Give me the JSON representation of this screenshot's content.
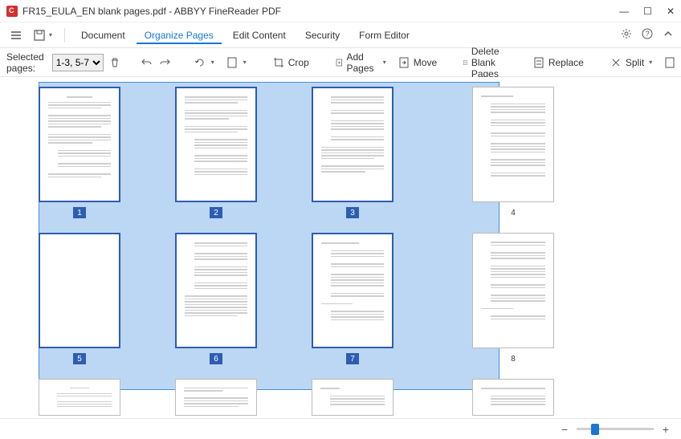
{
  "titlebar": {
    "document_name": "FR15_EULA_EN blank pages.pdf",
    "app_name": "ABBYY FineReader PDF"
  },
  "menubar": {
    "items": [
      "Document",
      "Organize Pages",
      "Edit Content",
      "Security",
      "Form Editor"
    ],
    "active_index": 1
  },
  "toolbar": {
    "selected_pages_label": "Selected pages:",
    "selected_pages_value": "1-3, 5-7",
    "crop_label": "Crop",
    "add_pages_label": "Add Pages",
    "move_label": "Move",
    "delete_blank_label": "Delete Blank Pages",
    "replace_label": "Replace",
    "split_label": "Split"
  },
  "pages": {
    "selected": [
      1,
      2,
      3,
      5,
      6,
      7
    ],
    "unselected": [
      4,
      8
    ],
    "labels": [
      "1",
      "2",
      "3",
      "4",
      "5",
      "6",
      "7",
      "8"
    ]
  },
  "zoom": {
    "value": 25
  }
}
